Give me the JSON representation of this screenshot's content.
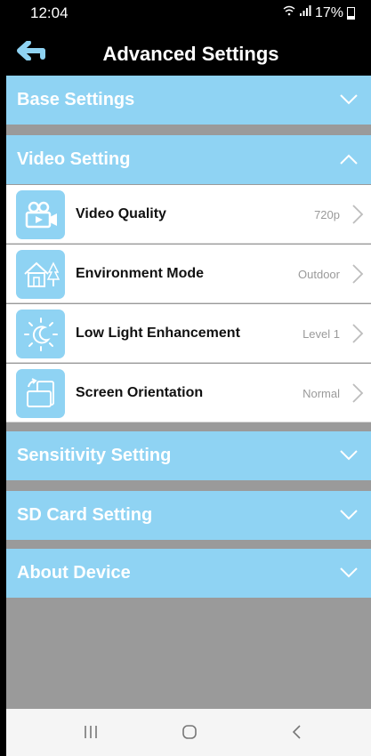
{
  "status": {
    "time": "12:04",
    "battery": "17%"
  },
  "header": {
    "title": "Advanced Settings"
  },
  "sections": {
    "base": "Base Settings",
    "video": "Video Setting",
    "sensitivity": "Sensitivity Setting",
    "sdcard": "SD Card Setting",
    "about": "About Device"
  },
  "video_rows": [
    {
      "label": "Video Quality",
      "value": "720p",
      "icon": "video-camera-icon"
    },
    {
      "label": "Environment Mode",
      "value": "Outdoor",
      "icon": "house-tree-icon"
    },
    {
      "label": "Low Light Enhancement",
      "value": "Level 1",
      "icon": "moon-sun-icon"
    },
    {
      "label": "Screen Orientation",
      "value": "Normal",
      "icon": "rotate-screen-icon"
    }
  ],
  "colors": {
    "section_bg": "#8fd3f3",
    "background": "#9a9a9a",
    "header_bg": "#000000"
  }
}
